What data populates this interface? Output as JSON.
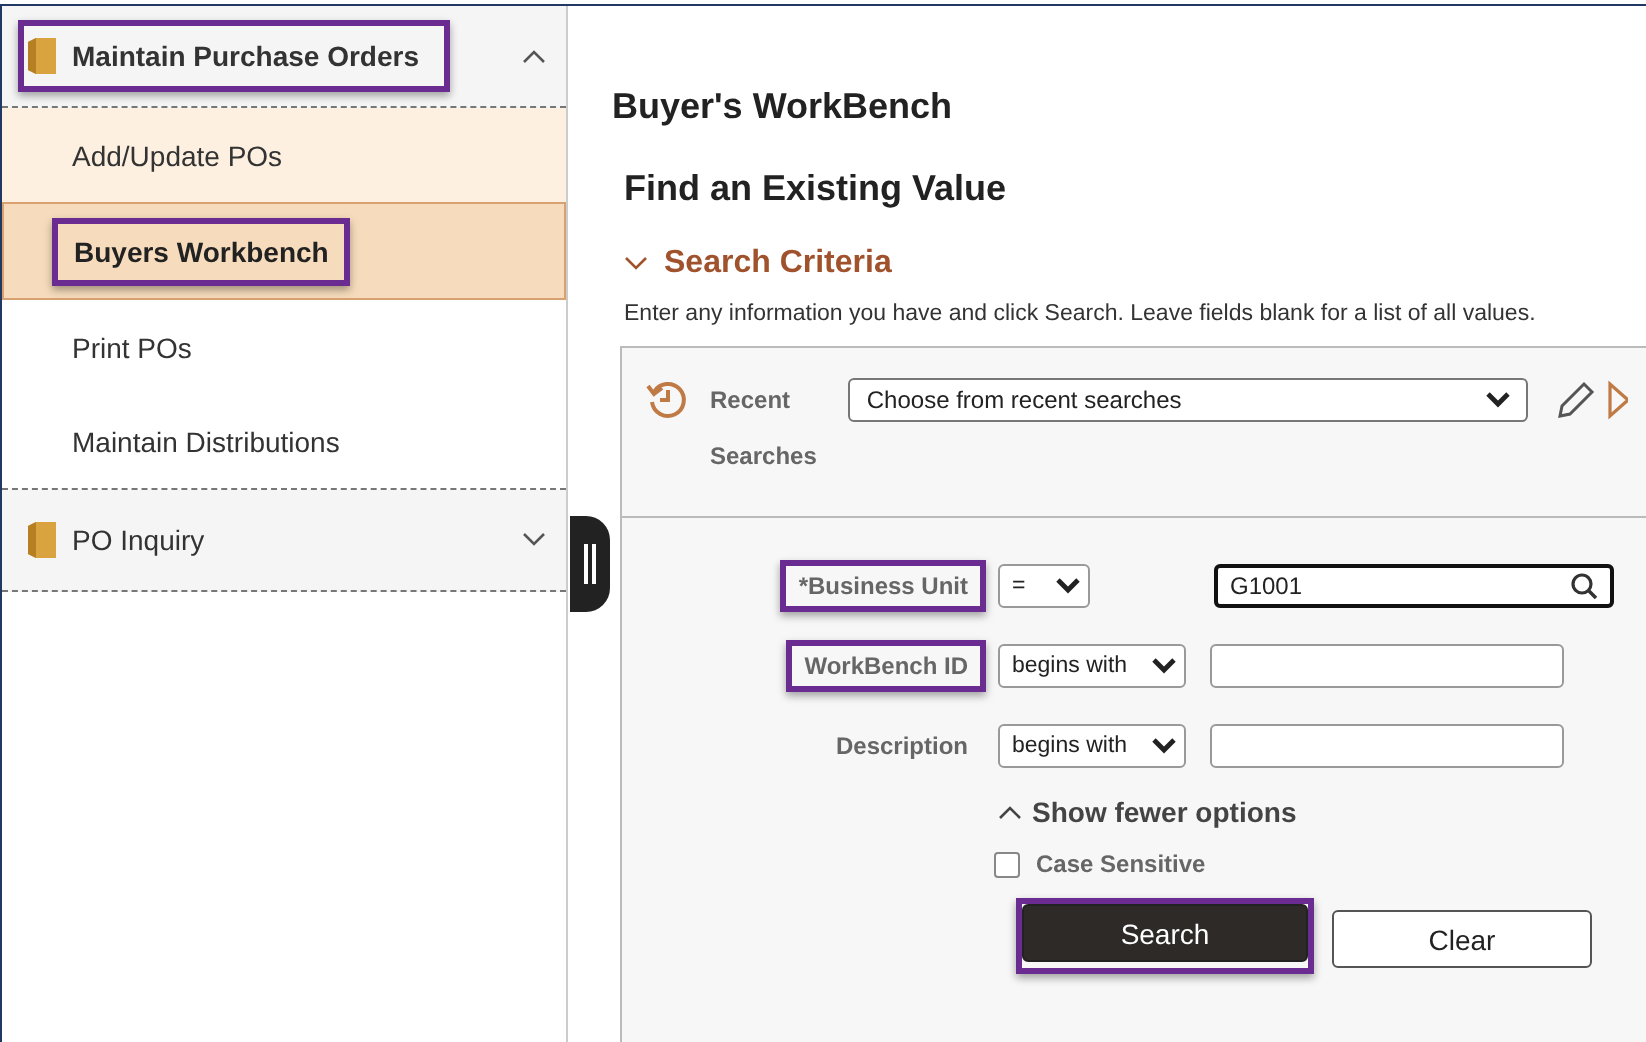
{
  "sidebar": {
    "groups": [
      {
        "label": "Maintain Purchase Orders",
        "expanded": true,
        "highlighted": true,
        "children": [
          {
            "label": "Add/Update POs",
            "selected": false,
            "hovered": true,
            "highlighted": false
          },
          {
            "label": "Buyers Workbench",
            "selected": true,
            "hovered": false,
            "highlighted": true
          },
          {
            "label": "Print POs",
            "selected": false,
            "hovered": false,
            "highlighted": false
          },
          {
            "label": "Maintain Distributions",
            "selected": false,
            "hovered": false,
            "highlighted": false
          }
        ]
      },
      {
        "label": "PO Inquiry",
        "expanded": false,
        "highlighted": false
      }
    ]
  },
  "page": {
    "title": "Buyer's WorkBench",
    "heading": "Find an Existing Value",
    "section": {
      "label": "Search Criteria",
      "expanded": true
    },
    "instructions": "Enter any information you have and click Search. Leave fields blank for a list of all values.",
    "recent": {
      "label_line_1": "Recent",
      "label_line_2": "Searches",
      "placeholder": "Choose from recent searches"
    },
    "fields": [
      {
        "label": "*Business Unit",
        "highlighted": true,
        "operator": "=",
        "kind": "lookup",
        "value": "G1001",
        "focused": true
      },
      {
        "label": "WorkBench ID",
        "highlighted": true,
        "operator": "begins with",
        "kind": "text",
        "focused": false
      },
      {
        "label": "Description",
        "highlighted": false,
        "operator": "begins with",
        "kind": "text",
        "focused": false
      }
    ],
    "toggle": "Show fewer options",
    "case_sensitive": {
      "label": "Case Sensitive",
      "checked": false
    },
    "buttons": [
      {
        "label": "Search",
        "kind": "primary",
        "highlighted": true
      },
      {
        "label": "Clear",
        "kind": "secondary",
        "highlighted": false
      }
    ]
  }
}
